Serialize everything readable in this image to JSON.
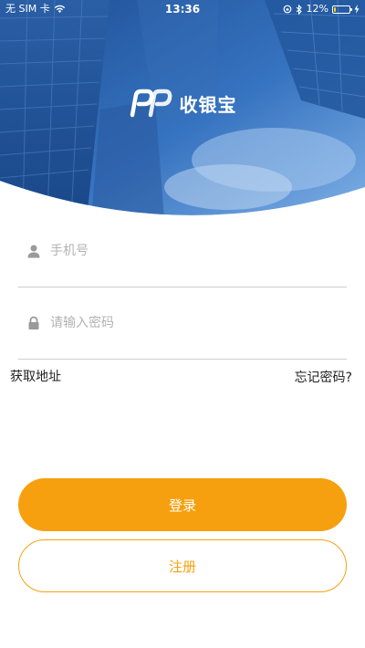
{
  "status_bar": {
    "carrier": "无 SIM 卡",
    "time": "13:36",
    "battery_percent_label": "12%",
    "battery_level": 0.12
  },
  "header": {
    "app_name": "收银宝"
  },
  "form": {
    "phone_placeholder": "手机号",
    "password_placeholder": "请输入密码",
    "get_address_label": "获取地址",
    "forgot_password_label": "忘记密码?"
  },
  "actions": {
    "login_label": "登录",
    "register_label": "注册"
  },
  "colors": {
    "accent": "#f7a00f",
    "hero_blue": "#2e64ad",
    "icon_gray": "#9a9a9a"
  }
}
